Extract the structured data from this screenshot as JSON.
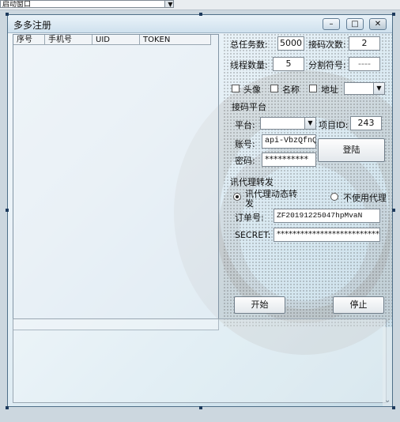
{
  "top_combo": {
    "value": "启动窗口"
  },
  "window": {
    "title": "多多注册"
  },
  "titlebar_buttons": {
    "minimize": "–",
    "maximize": "□",
    "close": "✕"
  },
  "list": {
    "columns": [
      "序号",
      "手机号",
      "UID",
      "TOKEN"
    ]
  },
  "settings": {
    "total_tasks_label": "总任务数:",
    "total_tasks_value": "5000",
    "receive_times_label": "接码次数:",
    "receive_times_value": "2",
    "threads_label": "线程数量:",
    "threads_value": "5",
    "separator_label": "分割符号:",
    "separator_value": "----",
    "avatar_label": "头像",
    "nickname_label": "名称",
    "address_label": "地址"
  },
  "sms_platform": {
    "group_label": "接码平台",
    "platform_label": "平台:",
    "project_id_label": "项目ID:",
    "project_id_value": "243",
    "account_label": "账号:",
    "account_value": "api-VbzQfnQS",
    "password_label": "密码:",
    "password_value": "**********",
    "login_button": "登陆"
  },
  "proxy": {
    "group_label": "讯代理转发",
    "dynamic_option": "讯代理动态转发",
    "no_proxy_option": "不使用代理",
    "order_label": "订单号:",
    "order_value": "ZF20191225047hpMvaN",
    "secret_label": "SECRET:",
    "secret_value": "******************************"
  },
  "actions": {
    "start_button": "开始",
    "stop_button": "停止"
  },
  "icons": {
    "dropdown": "▼",
    "scroll_down": "⌄"
  }
}
